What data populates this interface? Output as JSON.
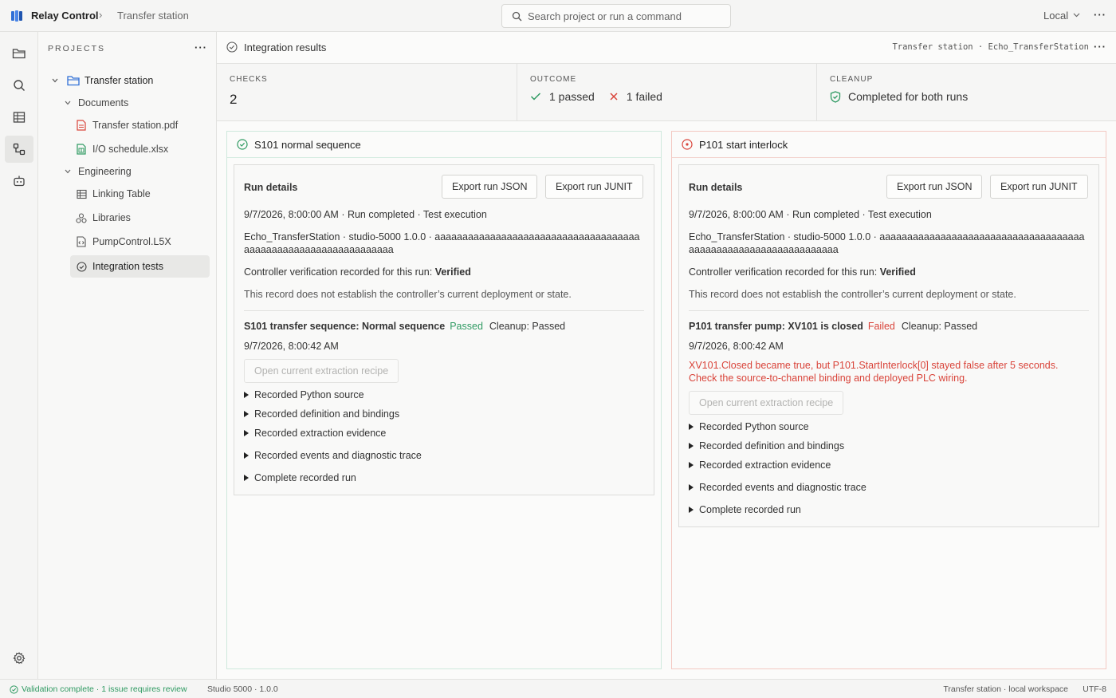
{
  "app": {
    "name": "Relay Control",
    "breadcrumb": "Transfer station",
    "search_placeholder": "Search project or run a command",
    "environment": "Local"
  },
  "sidebar": {
    "title": "PROJECTS",
    "project": "Transfer station",
    "groups": [
      {
        "label": "Documents",
        "items": [
          {
            "label": "Transfer station.pdf",
            "icon": "pdf-file-icon"
          },
          {
            "label": "I/O schedule.xlsx",
            "icon": "spreadsheet-file-icon"
          }
        ]
      },
      {
        "label": "Engineering",
        "items": [
          {
            "label": "Linking Table",
            "icon": "table-icon"
          },
          {
            "label": "Libraries",
            "icon": "libraries-icon"
          },
          {
            "label": "PumpControl.L5X",
            "icon": "code-file-icon"
          },
          {
            "label": "Integration tests",
            "icon": "check-circle-icon",
            "selected": true
          }
        ]
      }
    ]
  },
  "main": {
    "title": "Integration results",
    "path": "Transfer station · Echo_TransferStation",
    "stats": {
      "checks_label": "CHECKS",
      "checks_value": "2",
      "outcome_label": "OUTCOME",
      "passed_text": "1 passed",
      "failed_text": "1 failed",
      "cleanup_label": "CLEANUP",
      "cleanup_text": "Completed for both runs"
    },
    "runs": [
      {
        "name": "S101 normal sequence",
        "status": "pass",
        "details_title": "Run details",
        "export_json": "Export run JSON",
        "export_junit": "Export run JUNIT",
        "meta": "9/7/2026, 8:00:00 AM · Run completed · Test execution",
        "target_line1": "Echo_TransferStation · studio-5000 1.0.0 · aaaaaaaaaaaaaaaaaaaaaaaaaaaaaaaaaaaaa",
        "target_line2": "aaaaaaaaaaaaaaaaaaaaaaaaaaa",
        "verification_prefix": "Controller verification recorded for this run: ",
        "verification_value": "Verified",
        "disclaimer": "This record does not establish the controller’s current deployment or state.",
        "check_title": "S101 transfer sequence: Normal sequence",
        "check_result": "Passed",
        "check_cleanup": "Cleanup: Passed",
        "check_time": "9/7/2026, 8:00:42 AM",
        "error": "",
        "recipe_button": "Open current extraction recipe",
        "sections": [
          "Recorded Python source",
          "Recorded definition and bindings",
          "Recorded extraction evidence",
          "Recorded events and diagnostic trace",
          "Complete recorded run"
        ]
      },
      {
        "name": "P101 start interlock",
        "status": "fail",
        "details_title": "Run details",
        "export_json": "Export run JSON",
        "export_junit": "Export run JUNIT",
        "meta": "9/7/2026, 8:00:00 AM · Run completed · Test execution",
        "target_line1": "Echo_TransferStation · studio-5000 1.0.0 · aaaaaaaaaaaaaaaaaaaaaaaaaaaaaaaaaaaaa",
        "target_line2": "aaaaaaaaaaaaaaaaaaaaaaaaaaa",
        "verification_prefix": "Controller verification recorded for this run: ",
        "verification_value": "Verified",
        "disclaimer": "This record does not establish the controller’s current deployment or state.",
        "check_title": "P101 transfer pump: XV101 is closed",
        "check_result": "Failed",
        "check_cleanup": "Cleanup: Passed",
        "check_time": "9/7/2026, 8:00:42 AM",
        "error_line1": "XV101.Closed became true, but P101.StartInterlock[0] stayed false after 5 seconds.",
        "error_line2": "Check the source-to-channel binding and deployed PLC wiring.",
        "recipe_button": "Open current extraction recipe",
        "sections": [
          "Recorded Python source",
          "Recorded definition and bindings",
          "Recorded extraction evidence",
          "Recorded events and diagnostic trace",
          "Complete recorded run"
        ]
      }
    ]
  },
  "statusbar": {
    "validation": "Validation complete · 1 issue requires review",
    "version": "Studio 5000 · 1.0.0",
    "workspace": "Transfer station · local workspace",
    "encoding": "UTF-8"
  },
  "colors": {
    "pass": "#2f9a62",
    "fail": "#d9443a",
    "accent": "#2f6fd6"
  }
}
